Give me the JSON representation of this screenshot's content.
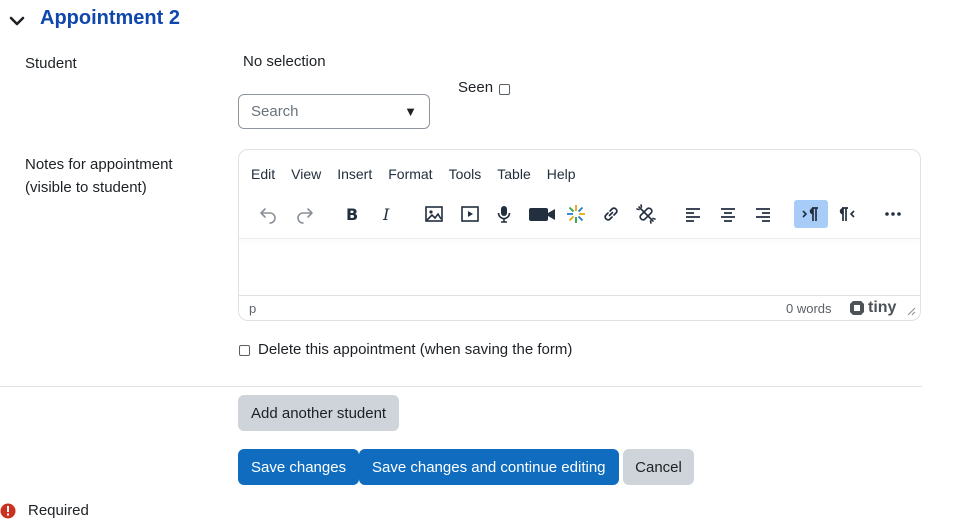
{
  "section": {
    "title": "Appointment 2"
  },
  "student": {
    "label": "Student",
    "selection_text": "No selection",
    "search_placeholder": "Search",
    "seen_label": "Seen"
  },
  "notes": {
    "label_line1": "Notes for appointment",
    "label_line2": "(visible to student)"
  },
  "editor": {
    "menu": [
      "Edit",
      "View",
      "Insert",
      "Format",
      "Tools",
      "Table",
      "Help"
    ],
    "status_path": "p",
    "word_count": "0 words",
    "brand": "tiny"
  },
  "delete_label": "Delete this appointment (when saving the form)",
  "buttons": {
    "add_student": "Add another student",
    "save": "Save changes",
    "save_continue": "Save changes and continue editing",
    "cancel": "Cancel"
  },
  "required_label": "Required",
  "colors": {
    "primary": "#0f6cbf",
    "title": "#0f47ad",
    "secondary": "#ced4da",
    "required": "#ca3120"
  }
}
